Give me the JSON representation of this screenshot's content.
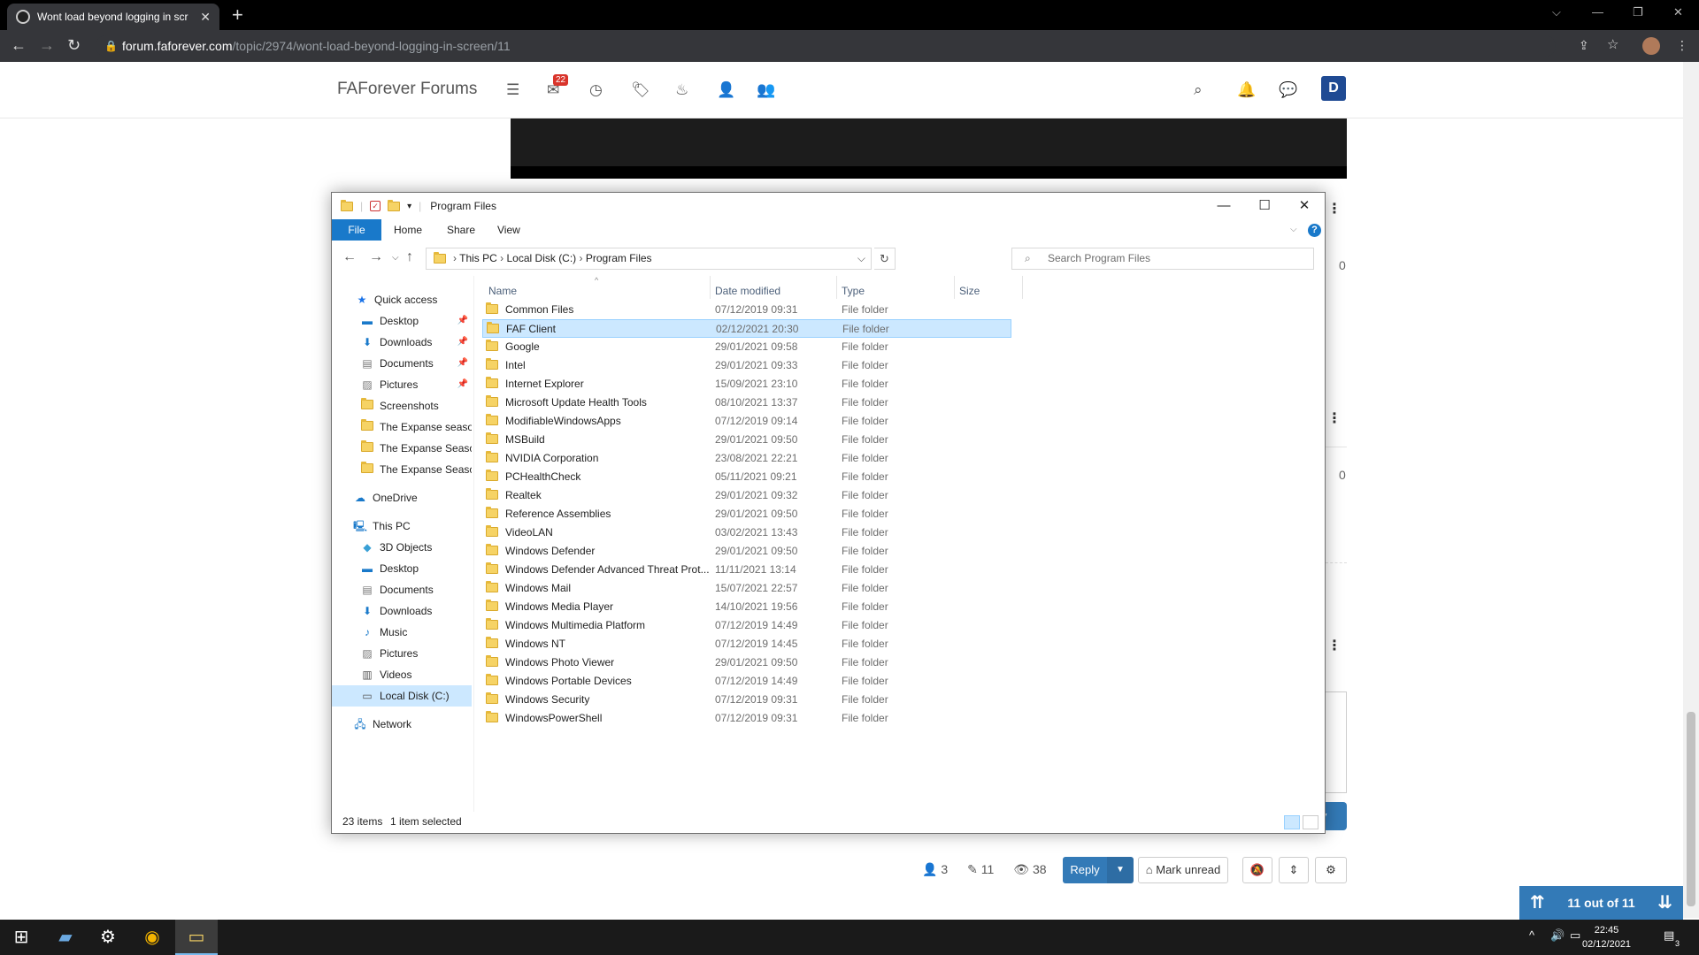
{
  "browser": {
    "tab_title": "Wont load beyond logging in scr",
    "url_host": "forum.faforever.com",
    "url_path": "/topic/2974/wont-load-beyond-logging-in-screen/11"
  },
  "forum": {
    "brand": "FAForever Forums",
    "notif_count": "22",
    "avatar_letter": "D",
    "side_count_a": "0",
    "side_count_b": "0",
    "submit_partial": "ly"
  },
  "post_tools": {
    "posters": "3",
    "posts": "11",
    "views": "38",
    "reply": "Reply",
    "mark_unread": "Mark unread"
  },
  "pager": {
    "label": "11 out of 11"
  },
  "explorer": {
    "title": "Program Files",
    "ribbon": {
      "file": "File",
      "home": "Home",
      "share": "Share",
      "view": "View"
    },
    "breadcrumb": [
      "This PC",
      "Local Disk (C:)",
      "Program Files"
    ],
    "search_placeholder": "Search Program Files",
    "columns": {
      "name": "Name",
      "date": "Date modified",
      "type": "Type",
      "size": "Size"
    },
    "nav": {
      "quick_access": "Quick access",
      "qa_items": [
        "Desktop",
        "Downloads",
        "Documents",
        "Pictures",
        "Screenshots",
        "The Expanse season",
        "The Expanse Seasor",
        "The Expanse Seasor"
      ],
      "onedrive": "OneDrive",
      "this_pc": "This PC",
      "pc_items": [
        "3D Objects",
        "Desktop",
        "Documents",
        "Downloads",
        "Music",
        "Pictures",
        "Videos",
        "Local Disk (C:)"
      ],
      "network": "Network"
    },
    "files": [
      {
        "name": "Common Files",
        "date": "07/12/2019 09:31",
        "type": "File folder"
      },
      {
        "name": "FAF Client",
        "date": "02/12/2021 20:30",
        "type": "File folder"
      },
      {
        "name": "Google",
        "date": "29/01/2021 09:58",
        "type": "File folder"
      },
      {
        "name": "Intel",
        "date": "29/01/2021 09:33",
        "type": "File folder"
      },
      {
        "name": "Internet Explorer",
        "date": "15/09/2021 23:10",
        "type": "File folder"
      },
      {
        "name": "Microsoft Update Health Tools",
        "date": "08/10/2021 13:37",
        "type": "File folder"
      },
      {
        "name": "ModifiableWindowsApps",
        "date": "07/12/2019 09:14",
        "type": "File folder"
      },
      {
        "name": "MSBuild",
        "date": "29/01/2021 09:50",
        "type": "File folder"
      },
      {
        "name": "NVIDIA Corporation",
        "date": "23/08/2021 22:21",
        "type": "File folder"
      },
      {
        "name": "PCHealthCheck",
        "date": "05/11/2021 09:21",
        "type": "File folder"
      },
      {
        "name": "Realtek",
        "date": "29/01/2021 09:32",
        "type": "File folder"
      },
      {
        "name": "Reference Assemblies",
        "date": "29/01/2021 09:50",
        "type": "File folder"
      },
      {
        "name": "VideoLAN",
        "date": "03/02/2021 13:43",
        "type": "File folder"
      },
      {
        "name": "Windows Defender",
        "date": "29/01/2021 09:50",
        "type": "File folder"
      },
      {
        "name": "Windows Defender Advanced Threat Prot...",
        "date": "11/11/2021 13:14",
        "type": "File folder"
      },
      {
        "name": "Windows Mail",
        "date": "15/07/2021 22:57",
        "type": "File folder"
      },
      {
        "name": "Windows Media Player",
        "date": "14/10/2021 19:56",
        "type": "File folder"
      },
      {
        "name": "Windows Multimedia Platform",
        "date": "07/12/2019 14:49",
        "type": "File folder"
      },
      {
        "name": "Windows NT",
        "date": "07/12/2019 14:45",
        "type": "File folder"
      },
      {
        "name": "Windows Photo Viewer",
        "date": "29/01/2021 09:50",
        "type": "File folder"
      },
      {
        "name": "Windows Portable Devices",
        "date": "07/12/2019 14:49",
        "type": "File folder"
      },
      {
        "name": "Windows Security",
        "date": "07/12/2019 09:31",
        "type": "File folder"
      },
      {
        "name": "WindowsPowerShell",
        "date": "07/12/2019 09:31",
        "type": "File folder"
      }
    ],
    "selected_index": 1,
    "status_count": "23 items",
    "status_selected": "1 item selected"
  },
  "taskbar": {
    "time": "22:45",
    "date": "02/12/2021",
    "notif": "3"
  }
}
